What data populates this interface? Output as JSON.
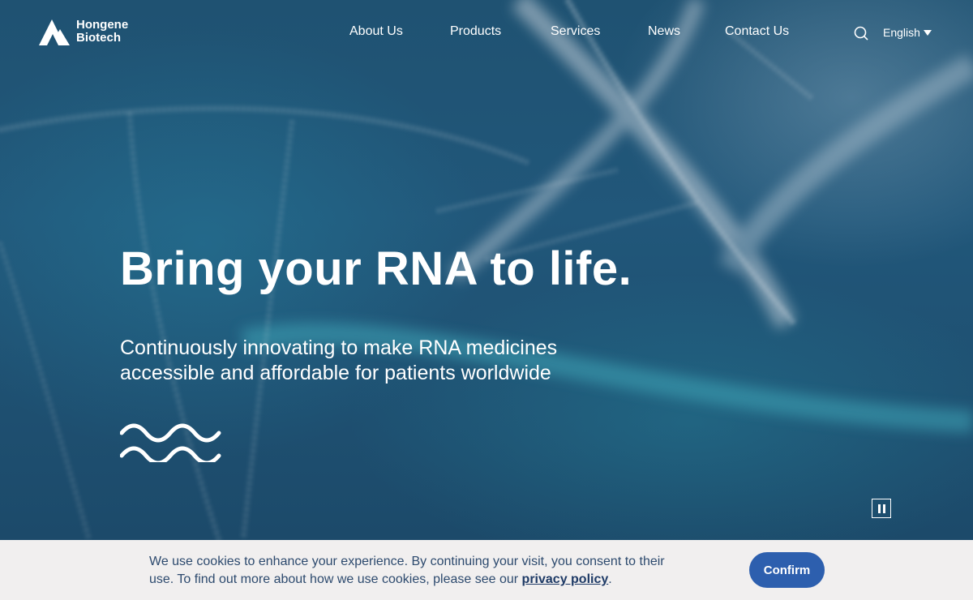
{
  "brand": {
    "line1": "Hongene",
    "line2": "Biotech"
  },
  "nav": {
    "items": [
      {
        "label": "About Us"
      },
      {
        "label": "Products"
      },
      {
        "label": "Services"
      },
      {
        "label": "News"
      },
      {
        "label": "Contact Us"
      }
    ],
    "language": "English"
  },
  "hero": {
    "headline": "Bring your RNA to life.",
    "subheadline": "Continuously innovating to make RNA medicines accessible and affordable for patients worldwide"
  },
  "cookie_banner": {
    "text_before": "We use cookies to enhance your experience. By continuing your visit, you consent to their use. To find out more about how we use cookies, please see our ",
    "link_text": "privacy policy",
    "text_after": ".",
    "confirm_label": "Confirm"
  },
  "icons": {
    "logo": "mountain-logo-icon",
    "search": "search-icon",
    "language_caret": "caret-down-icon",
    "waves": "waves-icon",
    "pause": "pause-icon"
  },
  "colors": {
    "cookie_bg": "#f1efef",
    "confirm_button": "#2d5fae",
    "cookie_text": "#2d4a6e",
    "hero_bg": "#1f5272"
  }
}
